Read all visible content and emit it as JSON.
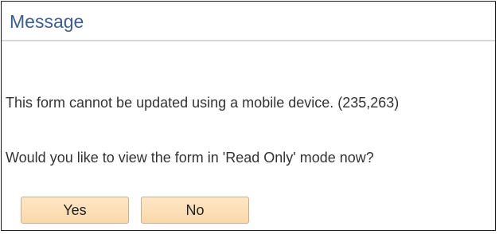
{
  "dialog": {
    "title": "Message",
    "message_lines": [
      "This form cannot be updated using a mobile device. (235,263)",
      "Would you like to view the form in 'Read Only' mode now?"
    ],
    "buttons": {
      "yes_label": "Yes",
      "no_label": "No"
    }
  },
  "colors": {
    "title": "#3b5f93",
    "button_fill": "#fbd8a9",
    "button_border": "#c9b08f",
    "header_divider": "#d6d6d6"
  }
}
